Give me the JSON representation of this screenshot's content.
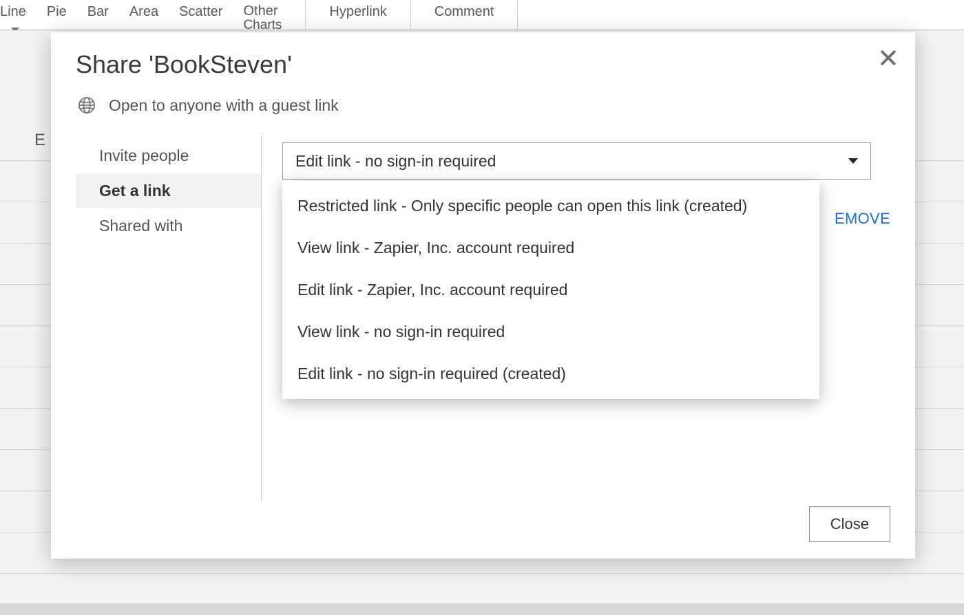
{
  "ribbon": {
    "items": [
      "Line",
      "Pie",
      "Bar",
      "Area",
      "Scatter",
      "Other",
      "Hyperlink",
      "Comment"
    ],
    "other_sub": "Charts"
  },
  "sheet": {
    "col_label": "E"
  },
  "modal": {
    "title": "Share 'BookSteven'",
    "subtitle": "Open to anyone with a guest link",
    "tabs": {
      "invite": "Invite people",
      "getlink": "Get a link",
      "sharedwith": "Shared with"
    },
    "dropdown_selected": "Edit link - no sign-in required",
    "dropdown_options": [
      "Restricted link - Only specific people can open this link (created)",
      "View link - Zapier, Inc. account required",
      "Edit link - Zapier, Inc. account required",
      "View link - no sign-in required",
      "Edit link - no sign-in required (created)"
    ],
    "remove_partial": "EMOVE",
    "close_button": "Close"
  }
}
